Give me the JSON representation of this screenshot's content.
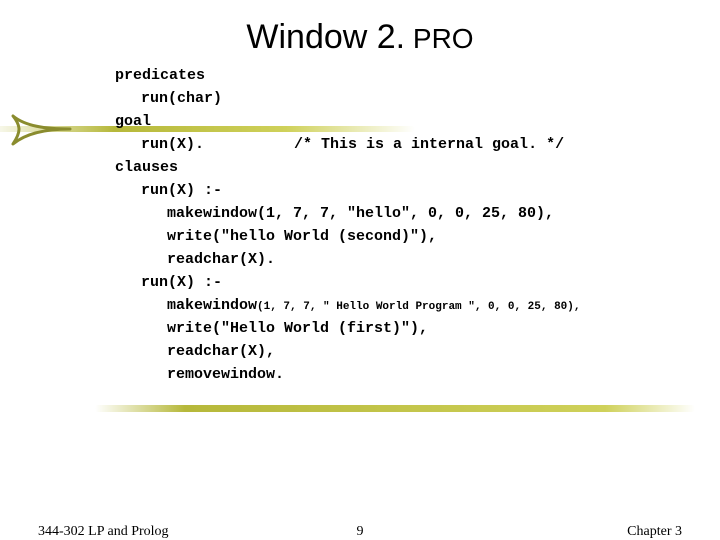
{
  "title": {
    "part1": "Window 2.",
    "part2": " PRO"
  },
  "code": {
    "l01": "predicates",
    "l02": "run(char)",
    "l03": "goal",
    "l04": "run(X).          /* This is a internal goal. */",
    "l05": "clauses",
    "l06": "run(X) :-",
    "l07": "makewindow(1, 7, 7, \"hello\", 0, 0, 25, 80),",
    "l08": "write(\"hello World (second)\"),",
    "l09": "readchar(X).",
    "l10": "run(X) :-",
    "l11a": "makewindow",
    "l11b": "(1, 7, 7, \" Hello World Program \", 0, 0, 25, 80),",
    "l12": "write(\"Hello World (first)\"),",
    "l13": "readchar(X),",
    "l14": "removewindow."
  },
  "footer": {
    "left": "344-302 LP and Prolog",
    "center": "9",
    "right": "Chapter 3"
  }
}
